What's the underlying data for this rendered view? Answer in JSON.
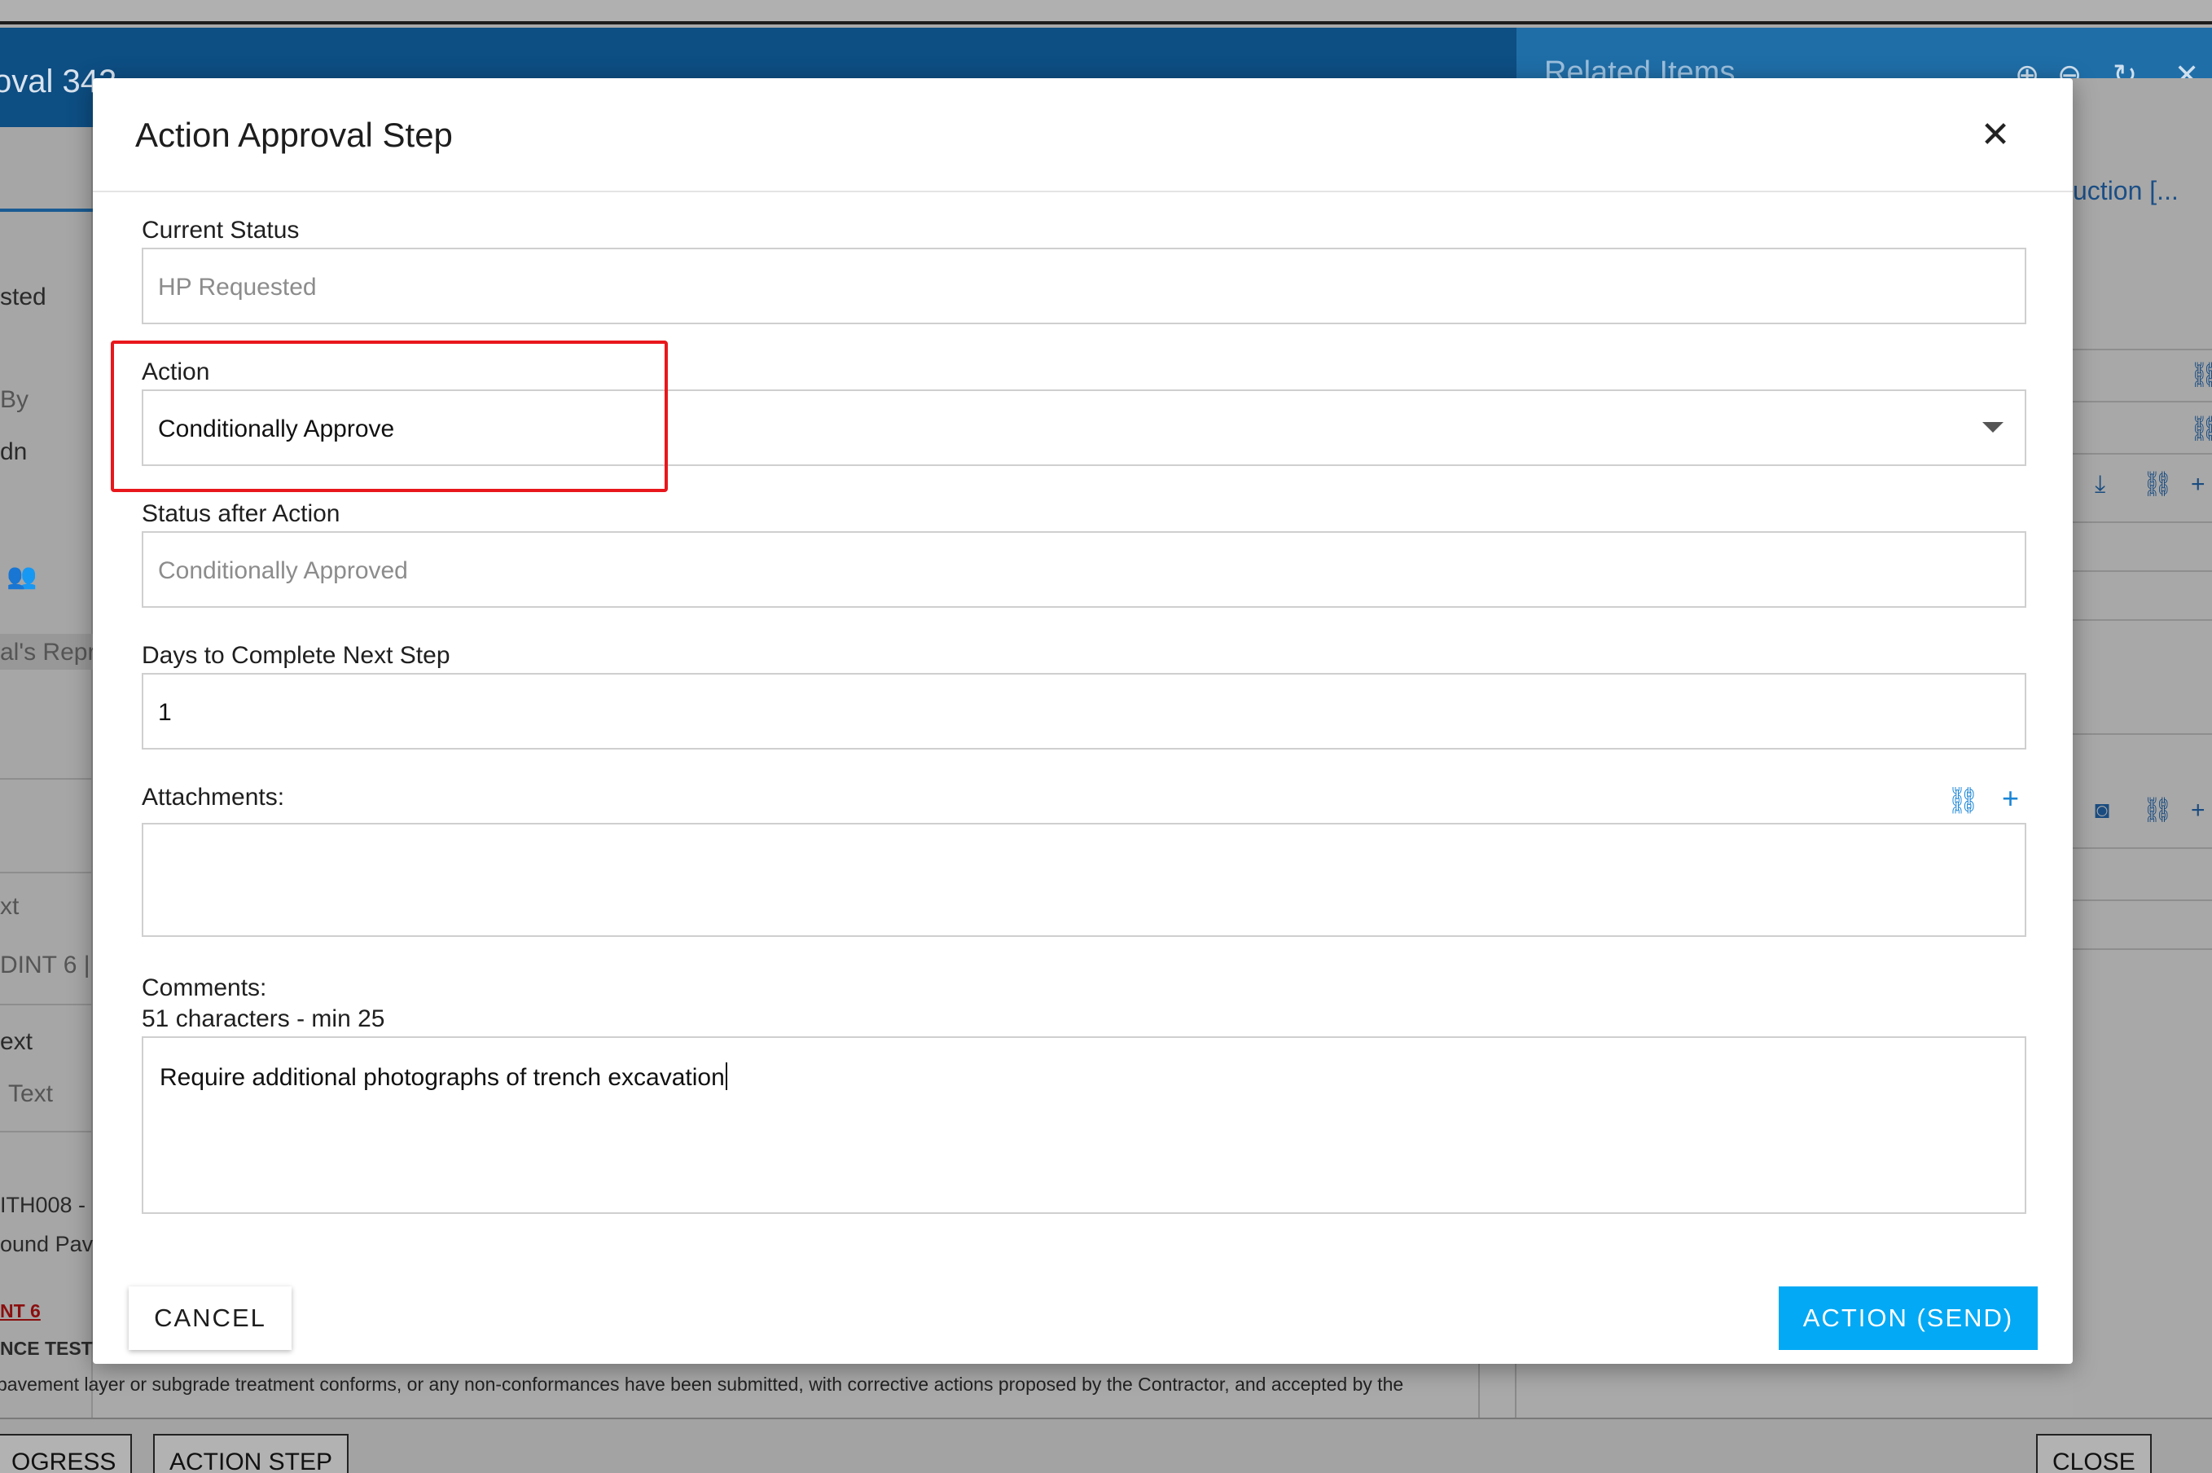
{
  "background": {
    "header_title": "oval 342",
    "related_title": "Related Items",
    "related_link": "uction [...",
    "left_labels": [
      "sted",
      "By",
      "dn",
      "al's Repr",
      "xt",
      "DINT 6 |",
      "ext",
      "Text",
      "ITH008 -",
      "ound Pav",
      "NT 6",
      "NCE TESTI"
    ],
    "doc_text": "pavement layer or subgrade treatment conforms, or any non-conformances have been submitted, with corrective actions proposed by the Contractor, and accepted by the",
    "footer_buttons": [
      "OGRESS",
      "ACTION STEP",
      "CLOSE"
    ]
  },
  "modal": {
    "title": "Action Approval Step",
    "close_glyph": "✕",
    "current_status": {
      "label": "Current Status",
      "value": "HP Requested"
    },
    "action": {
      "label": "Action",
      "selected": "Conditionally Approve"
    },
    "status_after": {
      "label": "Status after Action",
      "value": "Conditionally Approved"
    },
    "days": {
      "label": "Days to Complete Next Step",
      "value": "1"
    },
    "attachments": {
      "label": "Attachments:"
    },
    "comments": {
      "label": "Comments:",
      "count": "51 characters - min 25",
      "value": "Require additional photographs of trench excavation"
    },
    "buttons": {
      "cancel": "CANCEL",
      "send": "ACTION (SEND)"
    }
  },
  "colors": {
    "accent": "#03a9f4",
    "highlight": "#e8171c",
    "header_bg": "#0d4e83"
  }
}
